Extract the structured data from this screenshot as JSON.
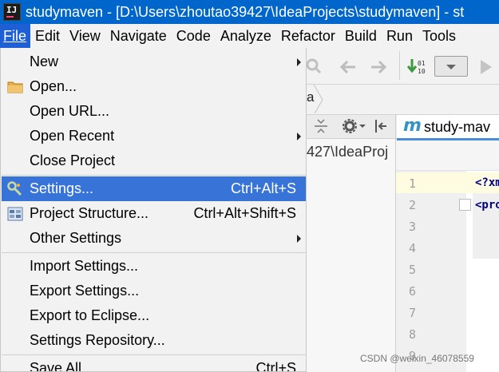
{
  "window": {
    "title": "studymaven - [D:\\Users\\zhoutao39427\\IdeaProjects\\studymaven] - st"
  },
  "menubar": [
    {
      "label": "File",
      "active": true
    },
    {
      "label": "Edit"
    },
    {
      "label": "View"
    },
    {
      "label": "Navigate"
    },
    {
      "label": "Code"
    },
    {
      "label": "Analyze"
    },
    {
      "label": "Refactor"
    },
    {
      "label": "Build"
    },
    {
      "label": "Run"
    },
    {
      "label": "Tools"
    }
  ],
  "file_menu": {
    "items": [
      {
        "label": "New",
        "submenu": true
      },
      {
        "label": "Open...",
        "icon": "folder-icon"
      },
      {
        "label": "Open URL..."
      },
      {
        "label": "Open Recent",
        "submenu": true
      },
      {
        "label": "Close Project"
      },
      {
        "label": "Settings...",
        "shortcut": "Ctrl+Alt+S",
        "icon": "wrench-icon",
        "selected": true
      },
      {
        "label": "Project Structure...",
        "shortcut": "Ctrl+Alt+Shift+S",
        "icon": "project-structure-icon"
      },
      {
        "label": "Other Settings",
        "submenu": true
      },
      {
        "label": "Import Settings..."
      },
      {
        "label": "Export Settings..."
      },
      {
        "label": "Export to Eclipse..."
      },
      {
        "label": "Settings Repository..."
      },
      {
        "label": "Save All",
        "shortcut": "Ctrl+S"
      }
    ]
  },
  "breadcrumb": {
    "tail": "a"
  },
  "project_panel": {
    "path": "427\\IdeaProj"
  },
  "editor": {
    "tab_label": "study-mav",
    "line_numbers": [
      "1",
      "2",
      "3",
      "4",
      "5",
      "6",
      "7",
      "8",
      "9"
    ],
    "code_line_1": "<?xm",
    "code_line_2": "<pro"
  },
  "watermark": "CSDN @weixin_46078559",
  "colors": {
    "titlebar": "#0066cc",
    "menu_selection": "#3874d8",
    "current_line": "#fdfbe0"
  }
}
